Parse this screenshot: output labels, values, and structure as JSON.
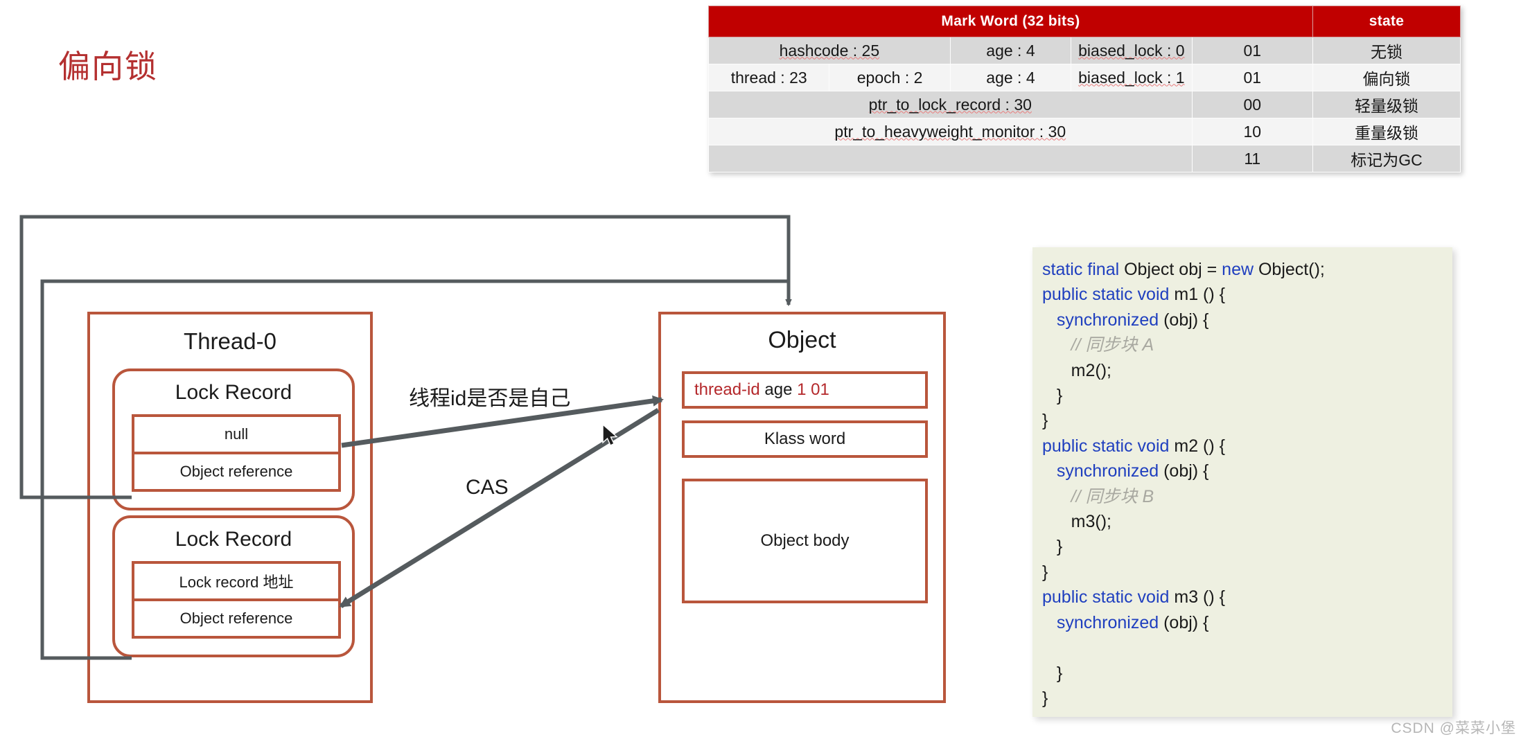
{
  "page": {
    "title": "偏向锁",
    "watermark": "CSDN @菜菜小堡"
  },
  "mark_word_table": {
    "header": {
      "mark_word": "Mark Word (32 bits)",
      "state": "state"
    },
    "rows": [
      {
        "cells": [
          "hashcode : 25",
          "age : 4",
          "biased_lock : 0"
        ],
        "bits": "01",
        "state": "无锁"
      },
      {
        "cells": [
          "thread : 23",
          "epoch : 2",
          "age : 4",
          "biased_lock : 1"
        ],
        "bits": "01",
        "state": "偏向锁"
      },
      {
        "cells": [
          "ptr_to_lock_record : 30"
        ],
        "bits": "00",
        "state": "轻量级锁"
      },
      {
        "cells": [
          "ptr_to_heavyweight_monitor : 30"
        ],
        "bits": "10",
        "state": "重量级锁"
      },
      {
        "cells": [
          ""
        ],
        "bits": "11",
        "state": "标记为GC"
      }
    ]
  },
  "code_panel": {
    "lines": [
      [
        {
          "t": "static final ",
          "c": "kw"
        },
        {
          "t": "Object obj = ",
          "c": ""
        },
        {
          "t": "new ",
          "c": "kw"
        },
        {
          "t": "Object();",
          "c": ""
        }
      ],
      [
        {
          "t": "public static void ",
          "c": "kw"
        },
        {
          "t": "m1 () {",
          "c": ""
        }
      ],
      [
        {
          "t": "   ",
          "c": ""
        },
        {
          "t": "synchronized ",
          "c": "kw"
        },
        {
          "t": "(obj) {",
          "c": ""
        }
      ],
      [
        {
          "t": "      // 同步块 A",
          "c": "cmt"
        }
      ],
      [
        {
          "t": "      m2();",
          "c": ""
        }
      ],
      [
        {
          "t": "   }",
          "c": ""
        }
      ],
      [
        {
          "t": "}",
          "c": ""
        }
      ],
      [
        {
          "t": "public static void ",
          "c": "kw"
        },
        {
          "t": "m2 () {",
          "c": ""
        }
      ],
      [
        {
          "t": "   ",
          "c": ""
        },
        {
          "t": "synchronized ",
          "c": "kw"
        },
        {
          "t": "(obj) {",
          "c": ""
        }
      ],
      [
        {
          "t": "      // 同步块 B",
          "c": "cmt"
        }
      ],
      [
        {
          "t": "      m3();",
          "c": ""
        }
      ],
      [
        {
          "t": "   }",
          "c": ""
        }
      ],
      [
        {
          "t": "}",
          "c": ""
        }
      ],
      [
        {
          "t": "public static void ",
          "c": "kw"
        },
        {
          "t": "m3 () {",
          "c": ""
        }
      ],
      [
        {
          "t": "   ",
          "c": ""
        },
        {
          "t": "synchronized ",
          "c": "kw"
        },
        {
          "t": "(obj) {",
          "c": ""
        }
      ],
      [
        {
          "t": "",
          "c": ""
        }
      ],
      [
        {
          "t": "   }",
          "c": ""
        }
      ],
      [
        {
          "t": "}",
          "c": ""
        }
      ]
    ]
  },
  "thread_box": {
    "title": "Thread-0",
    "lock_records": [
      {
        "title": "Lock Record",
        "slots": [
          "null",
          "Object reference"
        ]
      },
      {
        "title": "Lock Record",
        "slots": [
          "Lock record 地址",
          "Object reference"
        ]
      }
    ]
  },
  "object_box": {
    "title": "Object",
    "mark_word": {
      "thread_id": "thread-id",
      "age": "age",
      "bits": "1 01"
    },
    "klass_word": "Klass word",
    "object_body": "Object body"
  },
  "arrow_labels": {
    "thread_check": "线程id是否是自己",
    "cas": "CAS"
  },
  "colors": {
    "title_red": "#b43030",
    "box_border": "#b9563c",
    "connector_gray": "#555b5e",
    "table_header_red": "#c00000",
    "code_bg": "#eef0e1",
    "code_keyword": "#1f3fbf",
    "mark_red": "#b4282b"
  }
}
